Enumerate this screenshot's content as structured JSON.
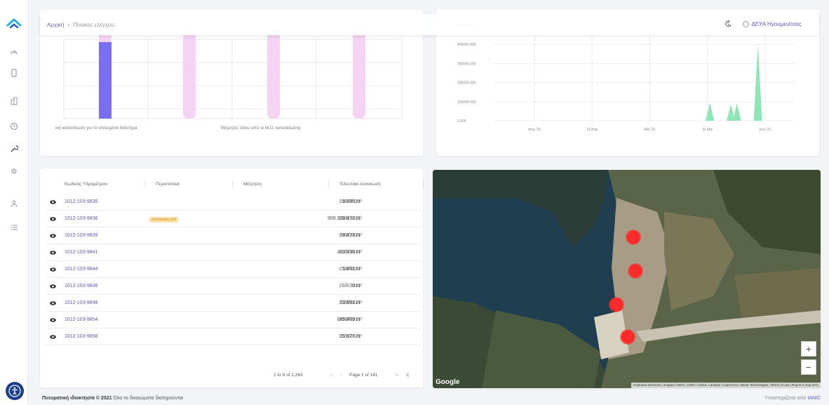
{
  "header": {
    "breadcrumb_home": "Αρχική",
    "breadcrumb_sep": "›",
    "breadcrumb_current": "Πίνακας ελέγχου",
    "user_label": "ΔΕΥΑ Ηγουμενίτσας"
  },
  "sidebar": {
    "items": [
      "gauge-icon",
      "device-icon",
      "buildings-icon",
      "clock-icon",
      "wrench-icon",
      "gear-icon",
      "user-icon",
      "list-icon"
    ]
  },
  "bar_card": {
    "legend_1": "ική κατανάλωση για το επιλεγμένο διάστημα",
    "legend_2": "Μετρητές πάνω από το Μ.Ο. κατανάλωσης",
    "colors": {
      "primary": "#7b6df0",
      "secondary": "#f4d3f4"
    }
  },
  "chart_data": {
    "type": "area",
    "x": [
      "Απρ '21",
      "13 Απρ",
      "Μαι '21",
      "13 Μαι",
      "Ιουν '21"
    ],
    "yticks": [
      "0.000",
      "100000.000",
      "200000.000",
      "300000.000",
      "400000.000",
      "500000.000"
    ],
    "ylim": [
      0,
      500000
    ],
    "peaks": [
      {
        "at": 0.72,
        "value": 95000
      },
      {
        "at": 0.79,
        "value": 85000
      },
      {
        "at": 0.81,
        "value": 90000
      },
      {
        "at": 0.88,
        "value": 400000
      }
    ],
    "color": "#8ee6b6",
    "grid": true
  },
  "table": {
    "headers": [
      "Κωδικός Υδρομέτρου",
      "Περιστατικά",
      "Μέτρηση",
      "Τελευταία Ανανέωση"
    ],
    "rows": [
      {
        "code": "1012-103-9835",
        "badge": "",
        "meas": "8.585 m³",
        "date": "15/6/2021"
      },
      {
        "code": "1012-103-9836",
        "badge": "αντίστροφη ροή",
        "meas": "999.938,412 m³",
        "date": "15/6/2021"
      },
      {
        "code": "1012-103-9839",
        "badge": "",
        "meas": "74,413 m³",
        "date": "15/6/2021"
      },
      {
        "code": "1012-103-9841",
        "badge": "",
        "meas": "413,336 m³",
        "date": "15/6/2021"
      },
      {
        "code": "1012-103-9844",
        "badge": "",
        "meas": "1,461 m³",
        "date": "15/6/2021"
      },
      {
        "code": "1012-103-9845",
        "badge": "",
        "meas": "0 m³",
        "date": "15/6/2021"
      },
      {
        "code": "1012-103-9849",
        "badge": "",
        "meas": "23,881 m³",
        "date": "15/6/2021"
      },
      {
        "code": "1012-103-9854",
        "badge": "",
        "meas": "645,469 m³",
        "date": "15/6/2021"
      },
      {
        "code": "1012-103-9856",
        "badge": "",
        "meas": "11,927 m³",
        "date": "15/6/2021"
      }
    ],
    "pager_range": "1 to 9 of 1,263",
    "pager_page": "Page 1 of 141"
  },
  "map": {
    "google": "Google",
    "zoom_in": "+",
    "zoom_out": "−",
    "attribution": "Keyboard shortcuts | Imagery ©2021, CNES / Airbus, Landsat / Copernicus, Maxar Technologies | Terms of Use | Report a map error"
  },
  "footer": {
    "copyright_bold": "Πνευματική ιδιοκτησία © 2021",
    "copyright_rest": "Όλα τα δικαιώματα διατηρούνται",
    "support": "Υποστηρίζεται από",
    "brand": "IANIC"
  }
}
